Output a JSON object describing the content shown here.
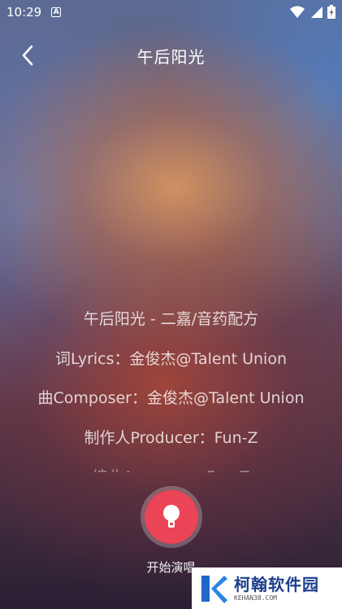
{
  "status_bar": {
    "time": "10:29",
    "notification_letter": "A"
  },
  "header": {
    "title": "午后阳光"
  },
  "lyrics": [
    "午后阳光 - 二嘉/音药配方",
    "词Lyrics：金俊杰@Talent Union",
    "曲Composer：金俊杰@Talent Union",
    "制作人Producer：Fun-Z",
    "编曲Arranger：Fun-Z"
  ],
  "sing": {
    "label": "开始演唱"
  },
  "watermark": {
    "name": "柯翰软件园",
    "url": "KEHAN38.COM"
  },
  "colors": {
    "accent": "#ec4457",
    "watermark_blue": "#1c3f8d"
  }
}
